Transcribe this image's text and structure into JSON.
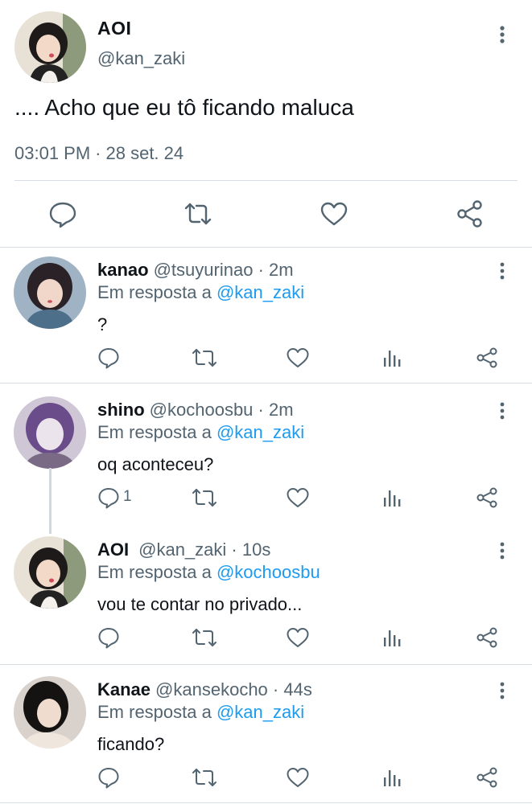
{
  "main_tweet": {
    "author_name": "AOI",
    "author_handle": "@kan_zaki",
    "text": ".... Acho que eu tô ficando maluca",
    "time": "03:01 PM",
    "separator": "·",
    "date": "28 set. 24",
    "actions": [
      "reply-icon",
      "retweet-icon",
      "like-icon",
      "share-icon"
    ]
  },
  "replies": [
    {
      "name": "kanao",
      "handle": "@tsuyurinao",
      "time": "· 2m",
      "reply_prefix": "Em resposta a",
      "reply_to": "@kan_zaki",
      "text": "?",
      "reply_count": ""
    },
    {
      "name": "shino",
      "handle": "@kochoosbu",
      "time": "· 2m",
      "reply_prefix": "Em resposta a",
      "reply_to": "@kan_zaki",
      "text": "oq aconteceu?",
      "reply_count": "1"
    },
    {
      "name": "AOI",
      "handle": "@kan_zaki",
      "time": "· 10s",
      "reply_prefix": "Em resposta a",
      "reply_to": "@kochoosbu",
      "text": "vou te contar no privado...",
      "reply_count": ""
    },
    {
      "name": "Kanae",
      "handle": "@kansekocho",
      "time": "· 44s",
      "reply_prefix": "Em resposta a",
      "reply_to": "@kan_zaki",
      "text": "ficando?",
      "reply_count": ""
    }
  ],
  "colors": {
    "link": "#1d9bf0",
    "secondary_text": "#536471",
    "icon": "#536471",
    "divider": "#d7dde2"
  }
}
